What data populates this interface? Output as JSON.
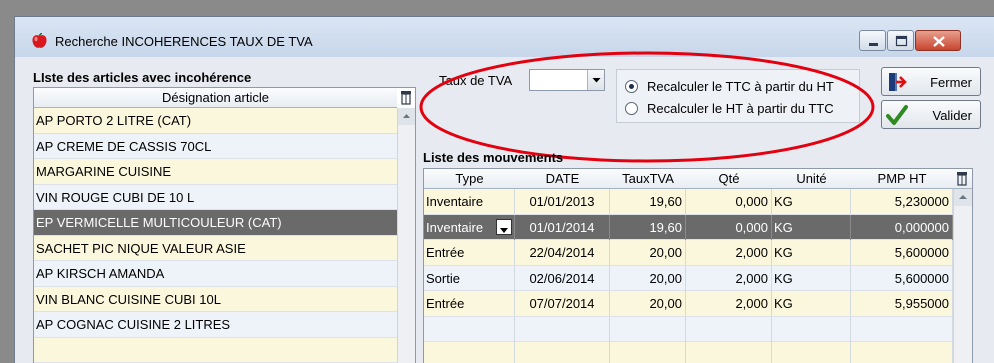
{
  "window": {
    "title": "Recherche INCOHERENCES TAUX DE TVA",
    "icon": "red-apple-icon"
  },
  "left": {
    "section_label": "LIste des articles avec incohérence",
    "column_header": "Désignation article",
    "items": [
      {
        "label": "AP PORTO 2 LITRE  (CAT)",
        "state": "alt"
      },
      {
        "label": "AP CREME DE CASSIS 70CL",
        "state": "norm"
      },
      {
        "label": "MARGARINE CUISINE",
        "state": "alt"
      },
      {
        "label": "VIN ROUGE CUBI DE 10 L",
        "state": "norm"
      },
      {
        "label": "EP VERMICELLE MULTICOULEUR  (CAT)",
        "state": "sel"
      },
      {
        "label": "SACHET PIC NIQUE VALEUR ASIE",
        "state": "alt"
      },
      {
        "label": "AP  KIRSCH AMANDA",
        "state": "norm"
      },
      {
        "label": "VIN BLANC CUISINE  CUBI 10L",
        "state": "alt"
      },
      {
        "label": "AP COGNAC CUISINE 2 LITRES",
        "state": "norm"
      },
      {
        "label": "",
        "state": "alt"
      }
    ]
  },
  "tva": {
    "label": "Taux de TVA",
    "value": ""
  },
  "options": {
    "radio_ttc": "Recalculer le TTC à partir du HT",
    "radio_ht": "Recalculer le HT à partir du TTC",
    "selected": "ttc"
  },
  "buttons": {
    "close": "Fermer",
    "validate": "Valider"
  },
  "movements": {
    "section_label": "Liste des mouvements",
    "columns": [
      "Type",
      "DATE",
      "TauxTVA",
      "Qté",
      "Unité",
      "PMP HT"
    ],
    "rows": [
      {
        "type": "Inventaire",
        "date": "01/01/2013",
        "taux": "19,60",
        "qte": "0,000",
        "unite": "KG",
        "pmp": "5,230000",
        "state": "alt"
      },
      {
        "type": "Inventaire",
        "date": "01/01/2014",
        "taux": "19,60",
        "qte": "0,000",
        "unite": "KG",
        "pmp": "0,000000",
        "state": "sel"
      },
      {
        "type": "Entrée",
        "date": "22/04/2014",
        "taux": "20,00",
        "qte": "2,000",
        "unite": "KG",
        "pmp": "5,600000",
        "state": "alt"
      },
      {
        "type": "Sortie",
        "date": "02/06/2014",
        "taux": "20,00",
        "qte": "2,000",
        "unite": "KG",
        "pmp": "5,600000",
        "state": "norm"
      },
      {
        "type": "Entrée",
        "date": "07/07/2014",
        "taux": "20,00",
        "qte": "2,000",
        "unite": "KG",
        "pmp": "5,955000",
        "state": "alt"
      },
      {
        "type": "",
        "date": "",
        "taux": "",
        "qte": "",
        "unite": "",
        "pmp": "",
        "state": "norm"
      },
      {
        "type": "",
        "date": "",
        "taux": "",
        "qte": "",
        "unite": "",
        "pmp": "",
        "state": "alt"
      }
    ]
  },
  "colors": {
    "annotation_ring": "#e3000f",
    "selected_row": "#6a6a6a",
    "alt_row": "#fbf7dc"
  }
}
